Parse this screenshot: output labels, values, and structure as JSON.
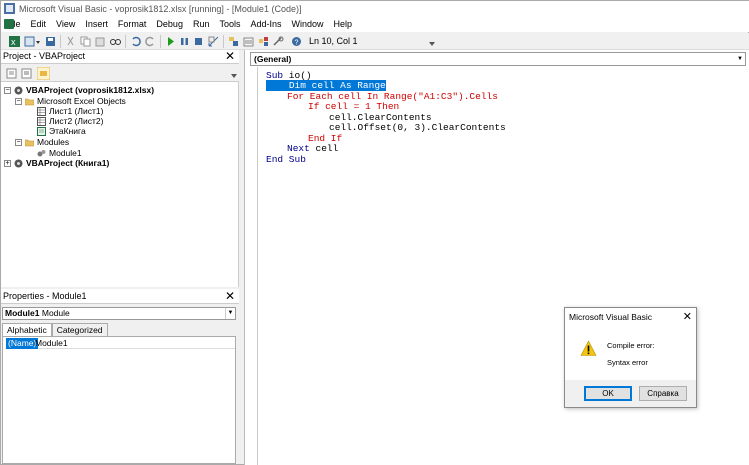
{
  "window": {
    "title": "Microsoft Visual Basic - voprosik1812.xlsx [running] - [Module1 (Code)]"
  },
  "menu": [
    "File",
    "Edit",
    "View",
    "Insert",
    "Format",
    "Debug",
    "Run",
    "Tools",
    "Add-Ins",
    "Window",
    "Help"
  ],
  "toolbar": {
    "cursor_position": "Ln 10, Col 1"
  },
  "project": {
    "title": "Project - VBAProject",
    "tree": {
      "root1": "VBAProject (voprosik1812.xlsx)",
      "excel_objects": "Microsoft Excel Objects",
      "sheet1": "Лист1 (Лист1)",
      "sheet2": "Лист2 (Лист2)",
      "workbook": "ЭтаКнига",
      "modules": "Modules",
      "module1": "Module1",
      "root2": "VBAProject (Книга1)"
    }
  },
  "properties": {
    "title": "Properties - Module1",
    "object_name": "Module1",
    "object_type": "Module",
    "tabs": [
      "Alphabetic",
      "Categorized"
    ],
    "row_key": "(Name)",
    "row_value": "Module1"
  },
  "code": {
    "general": "(General)",
    "lines": {
      "l1_kw": "Sub",
      "l1_rest": " io()",
      "l2": "Dim cell As Range",
      "l3": "For Each cell In Range(\"A1:C3\").Cells",
      "l4": "If cell = 1 Then",
      "l5": "cell.ClearContents",
      "l6": "cell.Offset(0, 3).ClearContents",
      "l7": "End If",
      "l8_kw": "Next",
      "l8_rest": " cell",
      "l9": "End Sub"
    }
  },
  "dialog": {
    "title": "Microsoft Visual Basic",
    "line1": "Compile error:",
    "line2": "Syntax error",
    "ok": "OK",
    "help": "Справка"
  }
}
